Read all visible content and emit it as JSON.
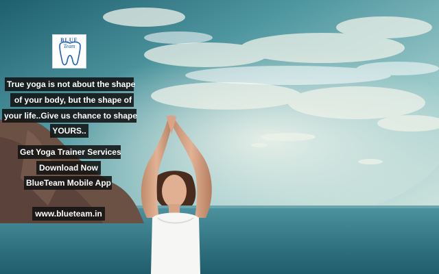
{
  "logo": {
    "line1": "BLUE",
    "line2": "Team",
    "icon": "tooth-logo-icon"
  },
  "quote": {
    "lines": [
      "True yoga is not about the shape",
      "of your body, but the shape of",
      "your life..Give us chance to shape",
      "YOURS.."
    ]
  },
  "promo": {
    "lines": [
      "Get Yoga Trainer Services",
      "Download Now",
      "BlueTeam Mobile App"
    ]
  },
  "website": "www.blueteam.in",
  "colors": {
    "sky_top": "#2f7a86",
    "sky_mid": "#8fc1c3",
    "sea": "#2c6f7c",
    "text_bg": "#121212",
    "logo_blue": "#1f5fb4"
  }
}
